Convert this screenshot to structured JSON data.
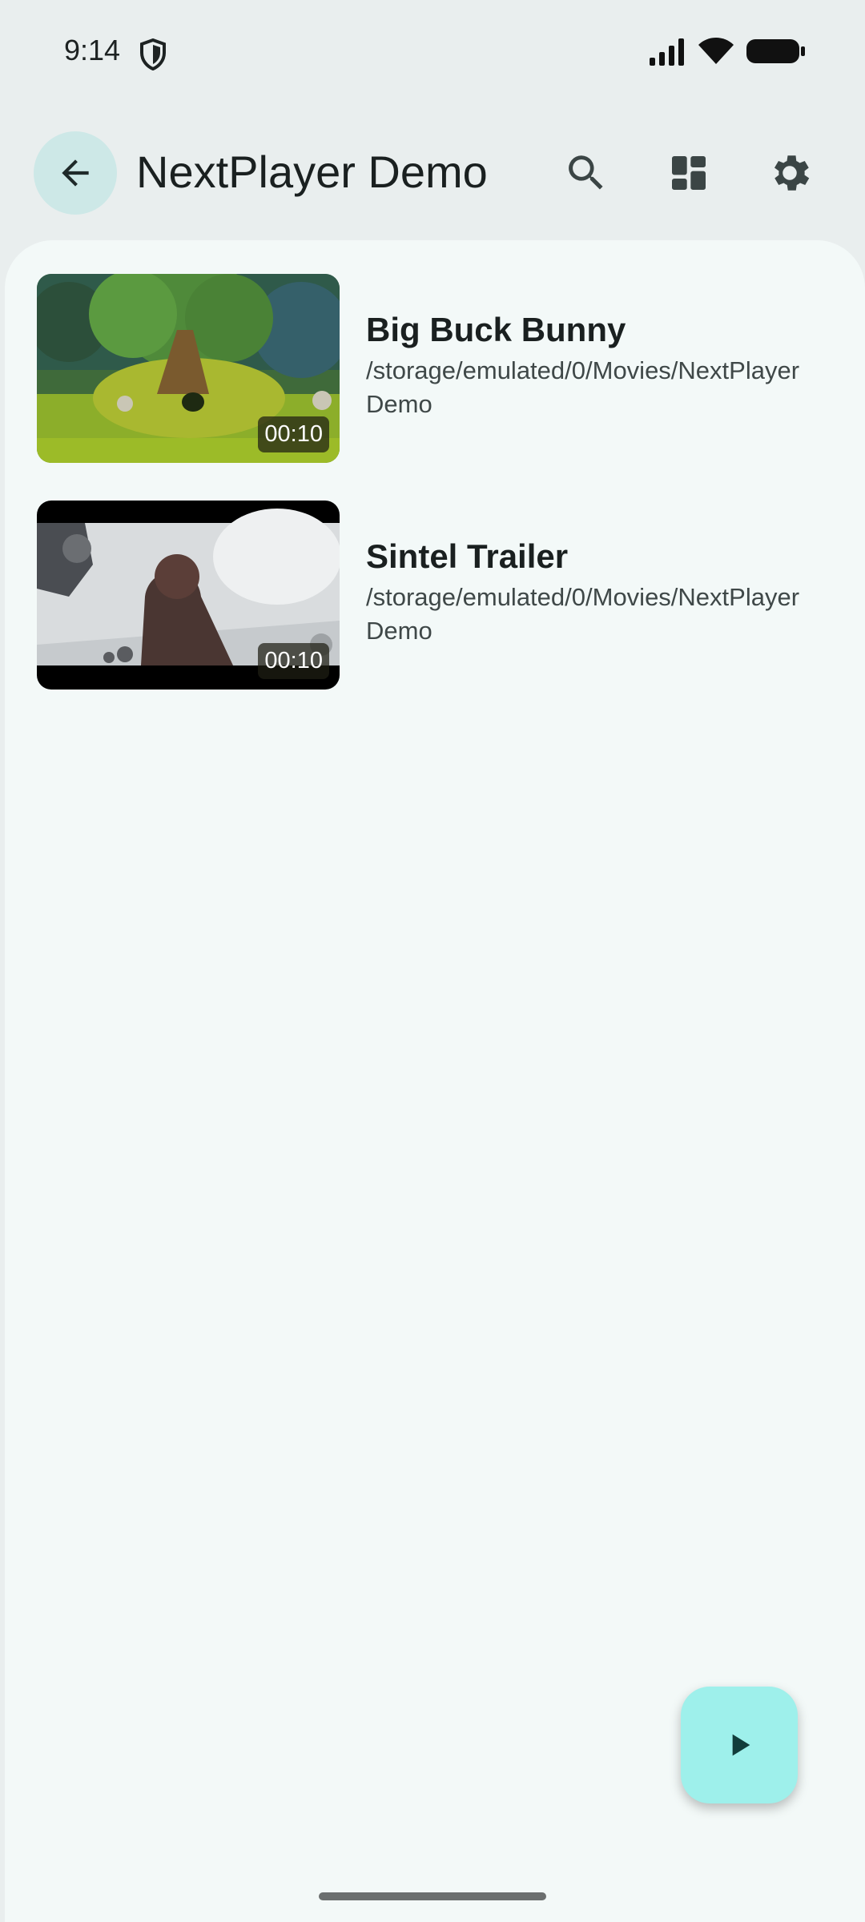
{
  "status_bar": {
    "time": "9:14"
  },
  "app_bar": {
    "title": "NextPlayer Demo",
    "icons": [
      "back-arrow-icon",
      "search-icon",
      "dashboard-icon",
      "settings-gear-icon"
    ]
  },
  "videos": [
    {
      "title": "Big Buck Bunny",
      "path": "/storage/emulated/0/Movies/NextPlayer Demo",
      "duration": "00:10"
    },
    {
      "title": "Sintel Trailer",
      "path": "/storage/emulated/0/Movies/NextPlayer Demo",
      "duration": "00:10"
    }
  ],
  "fab": {
    "icon": "play-icon"
  },
  "colors": {
    "background": "#e9eeee",
    "surface": "#f3f9f8",
    "back_button": "#cde8e7",
    "fab": "#9ef0eb"
  }
}
